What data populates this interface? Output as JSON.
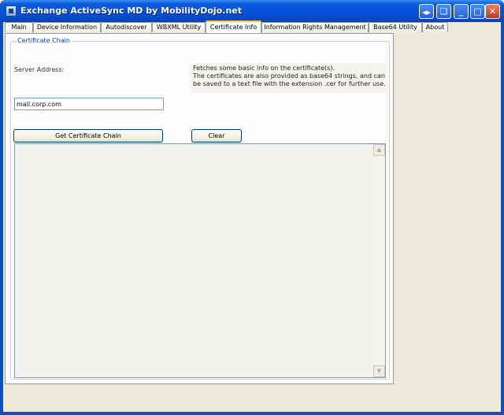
{
  "window": {
    "title": "Exchange ActiveSync MD by MobilityDojo.net",
    "controls": {
      "extra": "◀▶",
      "restore2": "❏",
      "minimize": "_",
      "maximize": "□",
      "close": "✕"
    }
  },
  "tabs": [
    {
      "label": "Main"
    },
    {
      "label": "Device Information"
    },
    {
      "label": "Autodiscover"
    },
    {
      "label": "WBXML Utility"
    },
    {
      "label": "Certificate Info",
      "active": true
    },
    {
      "label": "Information Rights Management"
    },
    {
      "label": "Base64 Utility"
    },
    {
      "label": "About"
    }
  ],
  "certificate_chain": {
    "group_title": "Certificate Chain",
    "server_address_label": "Server Address:",
    "server_address_value": "mail.corp.com",
    "description": [
      "Fetches some basic info on the certificate(s).",
      "The certificates are also provided as base64 strings, and can",
      "be saved to a text file with the extension .cer for further use."
    ],
    "get_button_label": "Get Certificate Chain",
    "clear_button_label": "Clear",
    "output_text": ""
  },
  "scrollbar": {
    "up_arrow": "▲",
    "down_arrow": "▼"
  },
  "colors": {
    "titlebar": "#0551D8",
    "group_title": "#0046D5",
    "active_tab_accent": "#FFC83C"
  }
}
